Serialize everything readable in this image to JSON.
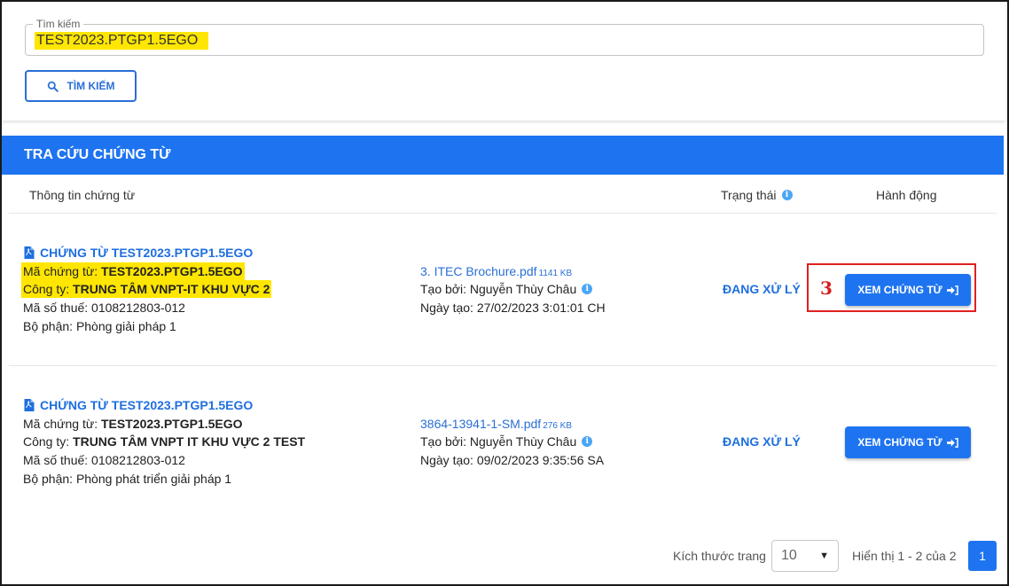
{
  "search": {
    "legend": "Tìm kiếm",
    "value": "TEST2023.PTGP1.5EGO",
    "button_label": "TÌM KIẾM"
  },
  "banner": {
    "title": "TRA CỨU CHỨNG TỪ"
  },
  "table": {
    "headers": {
      "info": "Thông tin chứng từ",
      "status": "Trạng thái",
      "action": "Hành động"
    },
    "rows": [
      {
        "title": "CHỨNG TỪ TEST2023.PTGP1.5EGO",
        "code_label": "Mã chứng từ: ",
        "code": "TEST2023.PTGP1.5EGO",
        "company_label": "Công ty: ",
        "company": "TRUNG TÂM VNPT-IT KHU VỰC 2",
        "tax_code": "Mã số thuế: 0108212803-012",
        "department": "Bộ phận: Phòng giải pháp 1",
        "file_name": "3. ITEC Brochure.pdf",
        "file_size": "1141 KB",
        "created_by": "Tạo bởi: Nguyễn Thùy Châu",
        "created_at": "Ngày tạo: 27/02/2023 3:01:01 CH",
        "status": "ĐANG XỬ LÝ",
        "action_label": "XEM CHỨNG TỪ"
      },
      {
        "title": "CHỨNG TỪ TEST2023.PTGP1.5EGO",
        "code_label": "Mã chứng từ: ",
        "code": "TEST2023.PTGP1.5EGO",
        "company_label": "Công ty: ",
        "company": "TRUNG TÂM VNPT IT KHU VỰC 2 TEST",
        "tax_code": "Mã số thuế: 0108212803-012",
        "department": "Bộ phận: Phòng phát triển giải pháp 1",
        "file_name": "3864-13941-1-SM.pdf",
        "file_size": "276 KB",
        "created_by": "Tạo bởi: Nguyễn Thùy Châu",
        "created_at": "Ngày tạo: 09/02/2023 9:35:56 SA",
        "status": "ĐANG XỬ LÝ",
        "action_label": "XEM CHỨNG TỪ"
      }
    ]
  },
  "annotation": {
    "step_number": "3"
  },
  "pagination": {
    "page_size_label": "Kích thước trang",
    "page_size": "10",
    "range_text": "Hiển thị 1 - 2 của 2",
    "current_page": "1"
  },
  "colors": {
    "accent": "#1e74f0",
    "highlight": "#ffe600",
    "annotation": "#e02020"
  }
}
